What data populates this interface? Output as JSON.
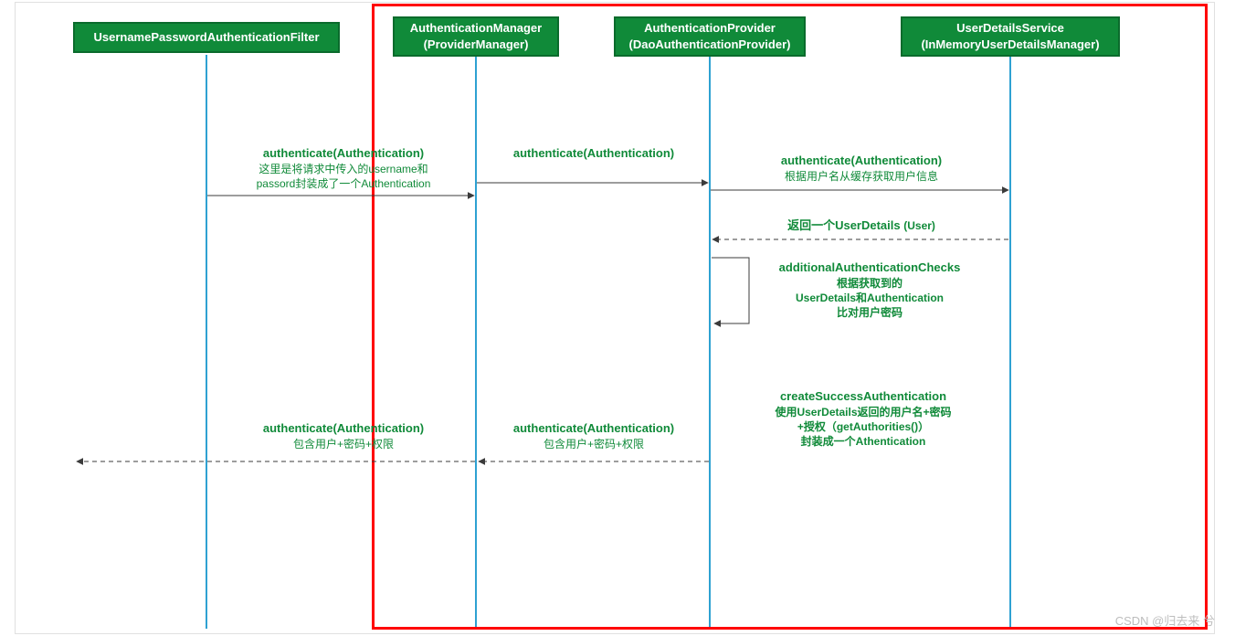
{
  "participants": {
    "p1": {
      "title": "UsernamePasswordAuthenticationFilter",
      "sub": ""
    },
    "p2": {
      "title": "AuthenticationManager",
      "sub": "(ProviderManager)"
    },
    "p3": {
      "title": "AuthenticationProvider",
      "sub": "(DaoAuthenticationProvider)"
    },
    "p4": {
      "title": "UserDetailsService",
      "sub": "(InMemoryUserDetailsManager)"
    }
  },
  "messages": {
    "m1": {
      "title": "authenticate(Authentication)",
      "note1": "这里是将请求中传入的username和",
      "note2": "passord封装成了一个Authentication"
    },
    "m2": {
      "title": "authenticate(Authentication)"
    },
    "m3": {
      "title": "authenticate(Authentication)",
      "note1": "根据用户名从缓存获取用户信息"
    },
    "m4": {
      "title_prefix": "返回一个UserDetails ",
      "title_suffix": "(User)"
    },
    "m5": {
      "title": "additionalAuthenticationChecks",
      "note1": "根据获取到的",
      "note2": "UserDetails和Authentication",
      "note3": "比对用户密码"
    },
    "m6": {
      "title": "createSuccessAuthentication",
      "note1": "使用UserDetails返回的用户名+密码",
      "note2": "+授权（getAuthorities()）",
      "note3": "封装成一个Athentication"
    },
    "m7": {
      "title": "authenticate(Authentication)",
      "note1": "包含用户+密码+权限"
    },
    "m8": {
      "title": "authenticate(Authentication)",
      "note1": "包含用户+密码+权限"
    }
  },
  "watermark": "CSDN @归去来 兮"
}
